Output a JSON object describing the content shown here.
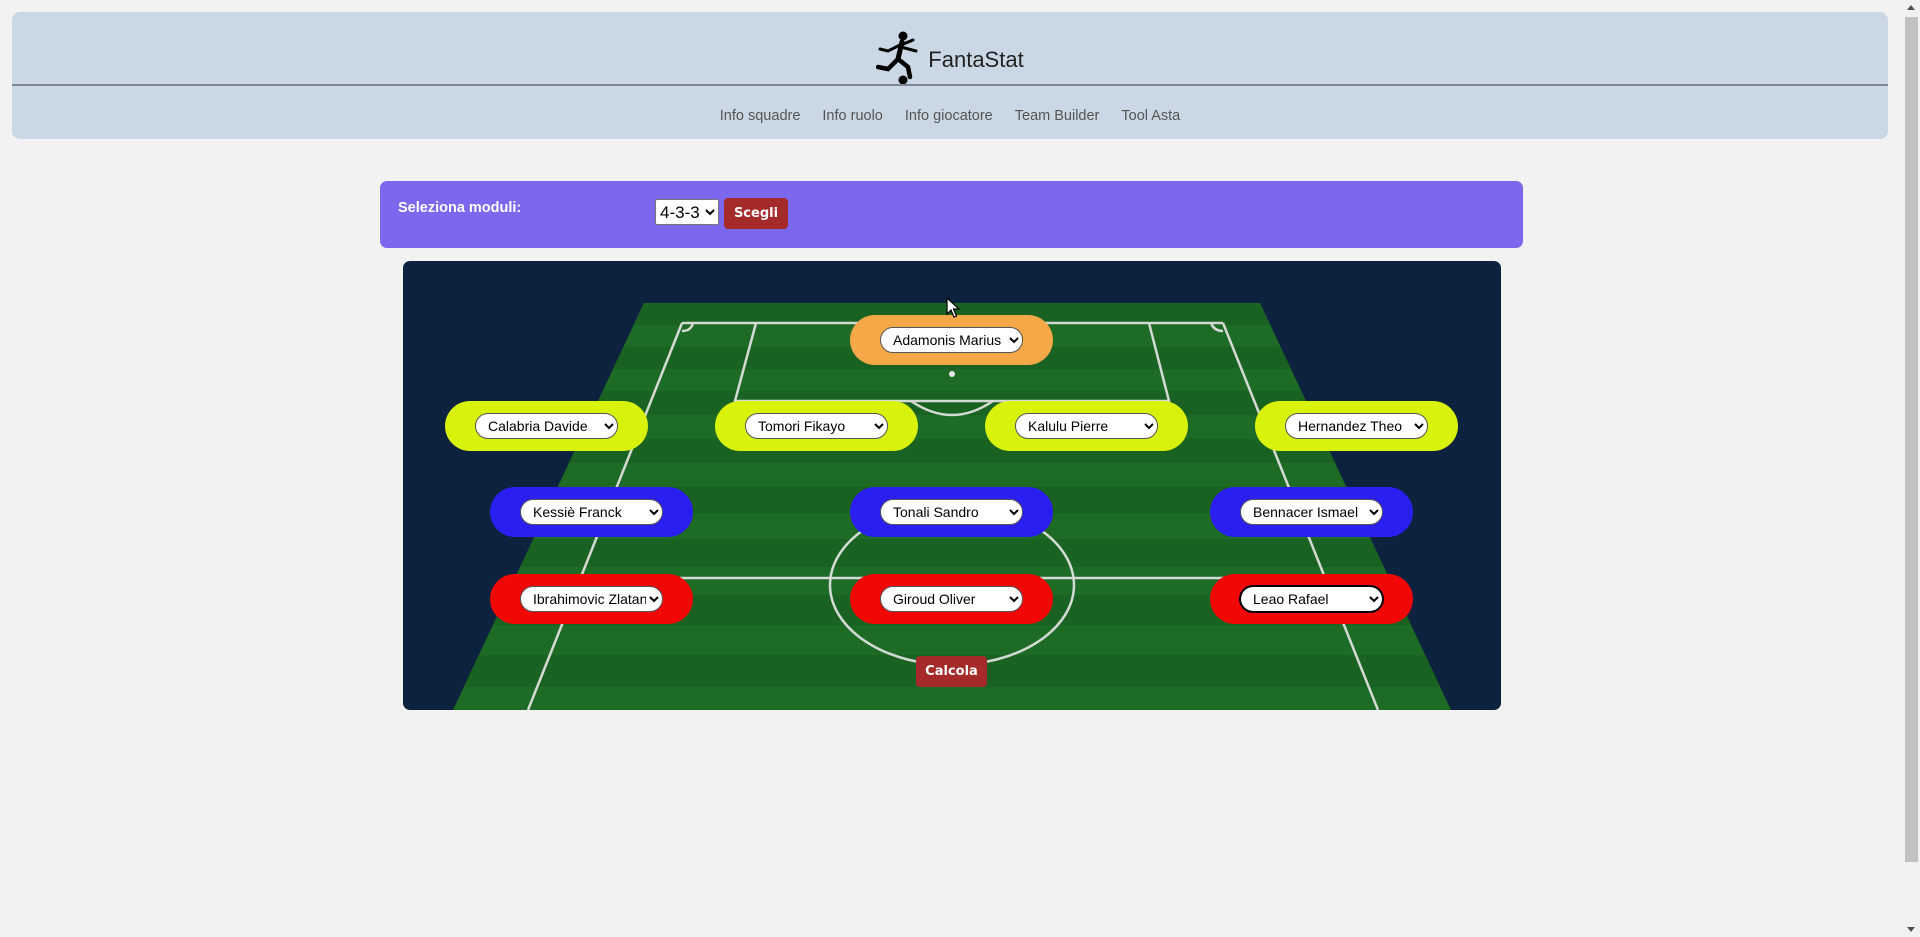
{
  "brand": {
    "name": "FantaStat",
    "icon": "soccer-player-icon"
  },
  "nav": [
    {
      "label": "Info squadre"
    },
    {
      "label": "Info ruolo"
    },
    {
      "label": "Info giocatore"
    },
    {
      "label": "Team Builder"
    },
    {
      "label": "Tool Asta"
    }
  ],
  "modules": {
    "label": "Seleziona moduli:",
    "selected": "4-3-3",
    "button": "Scegli"
  },
  "lineup": {
    "goalkeeper": [
      "Adamonis Marius"
    ],
    "defenders": [
      "Calabria Davide",
      "Tomori Fikayo",
      "Kalulu Pierre",
      "Hernandez Theo"
    ],
    "midfielders": [
      "Kessiè Franck",
      "Tonali Sandro",
      "Bennacer Ismael"
    ],
    "forwards": [
      "Ibrahimovic Zlatan",
      "Giroud Oliver",
      "Leao Rafael"
    ]
  },
  "colors": {
    "goalkeeper": "#f5a848",
    "defender": "#d8f20b",
    "midfielder": "#2a1ff0",
    "forward": "#f20707",
    "module_bar": "#7b68ee",
    "button": "#a52a2a",
    "header": "#c9d8e4",
    "pitch_bg": "#0d223f"
  },
  "calcola_button": "Calcola"
}
